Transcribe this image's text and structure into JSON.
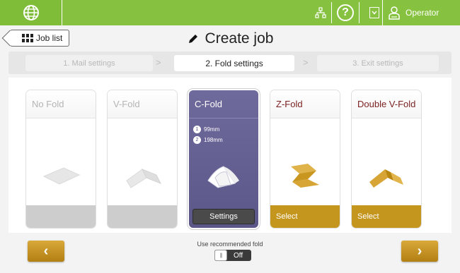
{
  "topbar": {
    "globe_icon": "globe-icon",
    "network_icon": "network-icon",
    "help_label": "?",
    "user_label": "Operator"
  },
  "header": {
    "back_label": "Job list",
    "title": "Create job"
  },
  "steps": [
    {
      "label": "1. Mail settings",
      "state": "done"
    },
    {
      "label": "2. Fold settings",
      "state": "active"
    },
    {
      "label": "3. Exit settings",
      "state": "pending"
    }
  ],
  "step_separator": ">",
  "folds": [
    {
      "name": "No Fold",
      "state": "disabled",
      "action": ""
    },
    {
      "name": "V-Fold",
      "state": "disabled",
      "action": ""
    },
    {
      "name": "C-Fold",
      "state": "selected",
      "action": "Settings",
      "measurements": [
        {
          "num": "1",
          "value": "99mm"
        },
        {
          "num": "2",
          "value": "198mm"
        }
      ]
    },
    {
      "name": "Z-Fold",
      "state": "enabled",
      "action": "Select"
    },
    {
      "name": "Double V-Fold",
      "state": "enabled",
      "action": "Select"
    }
  ],
  "footer": {
    "prev_label": "‹",
    "next_label": "›",
    "recommended_label": "Use recommended fold",
    "toggle_label": "Off",
    "toggle_knob": "|||"
  },
  "colors": {
    "topbar": "#86c23f",
    "selected_card": "#5b5788",
    "accent": "#c4961e",
    "title_enabled": "#7a1f1f"
  }
}
